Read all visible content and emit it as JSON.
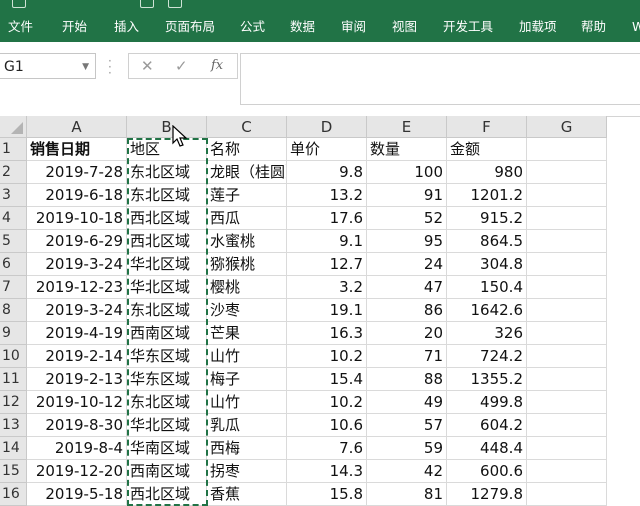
{
  "ribbon": {
    "tabs": [
      "文件",
      "开始",
      "插入",
      "页面布局",
      "公式",
      "数据",
      "审阅",
      "视图",
      "开发工具",
      "加载项",
      "帮助",
      "W"
    ]
  },
  "formula_bar": {
    "name_box": "G1",
    "cancel_glyph": "✕",
    "enter_glyph": "✓",
    "fx_glyph": "fx",
    "formula_value": ""
  },
  "sheet": {
    "columns": [
      "A",
      "B",
      "C",
      "D",
      "E",
      "F",
      "G"
    ],
    "rows": [
      [
        "销售日期",
        "地区",
        "名称",
        "单价",
        "数量",
        "金额"
      ],
      [
        "2019-7-28",
        "东北区域",
        "龙眼（桂圆）",
        "9.8",
        "100",
        "980"
      ],
      [
        "2019-6-18",
        "东北区域",
        "莲子",
        "13.2",
        "91",
        "1201.2"
      ],
      [
        "2019-10-18",
        "西北区域",
        "西瓜",
        "17.6",
        "52",
        "915.2"
      ],
      [
        "2019-6-29",
        "西北区域",
        "水蜜桃",
        "9.1",
        "95",
        "864.5"
      ],
      [
        "2019-3-24",
        "华北区域",
        "猕猴桃",
        "12.7",
        "24",
        "304.8"
      ],
      [
        "2019-12-23",
        "华北区域",
        "樱桃",
        "3.2",
        "47",
        "150.4"
      ],
      [
        "2019-3-24",
        "东北区域",
        "沙枣",
        "19.1",
        "86",
        "1642.6"
      ],
      [
        "2019-4-19",
        "西南区域",
        "芒果",
        "16.3",
        "20",
        "326"
      ],
      [
        "2019-2-14",
        "华东区域",
        "山竹",
        "10.2",
        "71",
        "724.2"
      ],
      [
        "2019-2-13",
        "华东区域",
        "梅子",
        "15.4",
        "88",
        "1355.2"
      ],
      [
        "2019-10-12",
        "东北区域",
        "山竹",
        "10.2",
        "49",
        "499.8"
      ],
      [
        "2019-8-30",
        "华北区域",
        "乳瓜",
        "10.6",
        "57",
        "604.2"
      ],
      [
        "2019-8-4",
        "华南区域",
        "西梅",
        "7.6",
        "59",
        "448.4"
      ],
      [
        "2019-12-20",
        "西南区域",
        "拐枣",
        "14.3",
        "42",
        "600.6"
      ],
      [
        "2019-5-18",
        "西北区域",
        "香蕉",
        "15.8",
        "81",
        "1279.8"
      ]
    ]
  }
}
